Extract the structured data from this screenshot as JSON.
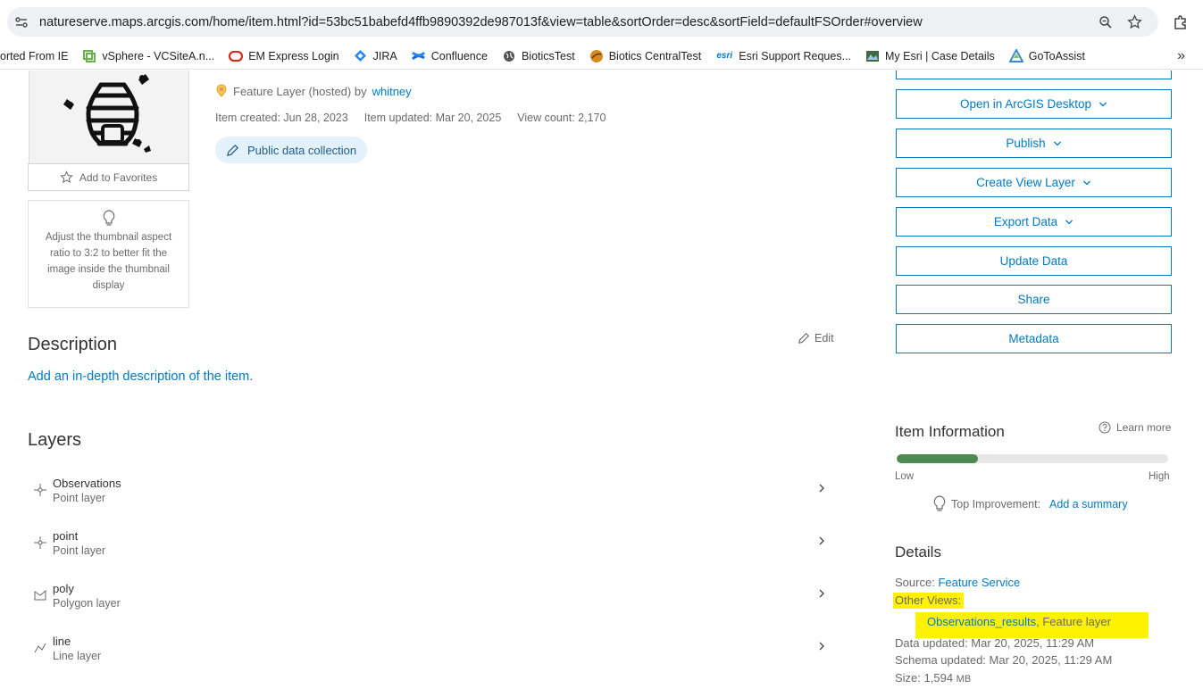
{
  "browser": {
    "url": "natureserve.maps.arcgis.com/home/item.html?id=53bc51babefd4ffb9890392de987013f&view=table&sortOrder=desc&sortField=defaultFSOrder#overview",
    "bookmarks": [
      {
        "label": "orted From IE",
        "icon": "none"
      },
      {
        "label": "vSphere - VCSiteA.n...",
        "icon": "vsphere-icon"
      },
      {
        "label": "EM Express Login",
        "icon": "oracle-icon"
      },
      {
        "label": "JIRA",
        "icon": "jira-icon"
      },
      {
        "label": "Confluence",
        "icon": "confluence-icon"
      },
      {
        "label": "BioticsTest",
        "icon": "globe-icon"
      },
      {
        "label": "Biotics CentralTest",
        "icon": "biotics-icon"
      },
      {
        "label": "Esri Support Reques...",
        "icon": "esri-icon"
      },
      {
        "label": "My Esri | Case Details",
        "icon": "myesri-icon"
      },
      {
        "label": "GoToAssist",
        "icon": "gotoassist-icon"
      }
    ],
    "bookmark_esri_mark": "esri"
  },
  "item": {
    "type_prefix": "Feature Layer (hosted) by",
    "owner": "whitney",
    "created": "Item created: Jun 28, 2023",
    "updated": "Item updated: Mar 20, 2025",
    "views": "View count: 2,170",
    "pill": "Public data collection",
    "favorites": "Add to Favorites",
    "thumb_tip": "Adjust the thumbnail aspect ratio to 3:2 to better fit the image inside the thumbnail display"
  },
  "description": {
    "heading": "Description",
    "edit": "Edit",
    "link": "Add an in-depth description of the item."
  },
  "layers": {
    "heading": "Layers",
    "items": [
      {
        "name": "Observations",
        "type": "Point layer",
        "icon": "point-layer-icon"
      },
      {
        "name": "point",
        "type": "Point layer",
        "icon": "point-layer-icon"
      },
      {
        "name": "poly",
        "type": "Polygon layer",
        "icon": "polygon-layer-icon"
      },
      {
        "name": "line",
        "type": "Line layer",
        "icon": "line-layer-icon"
      }
    ]
  },
  "actions": {
    "open_desktop": "Open in ArcGIS Desktop",
    "publish": "Publish",
    "create_view": "Create View Layer",
    "export": "Export Data",
    "update": "Update Data",
    "share": "Share",
    "metadata": "Metadata"
  },
  "item_info": {
    "heading": "Item Information",
    "learn_more": "Learn more",
    "low": "Low",
    "high": "High",
    "score_fraction": 0.3,
    "top_improvement_label": "Top Improvement:",
    "top_improvement_link": "Add a summary"
  },
  "details": {
    "heading": "Details",
    "source_label": "Source:",
    "source_link": "Feature Service",
    "other_views": "Other Views:",
    "view_name": "Observations_results",
    "view_type": ", Feature layer",
    "data_updated": "Data updated: Mar 20, 2025, 11:29 AM",
    "schema_updated": "Schema updated: Mar 20, 2025, 11:29 AM",
    "size_label": "Size: 1,594",
    "size_unit": "MB"
  },
  "colors": {
    "accent": "#007ac2",
    "highlight": "#fff200",
    "meter": "#4d8a4f"
  }
}
